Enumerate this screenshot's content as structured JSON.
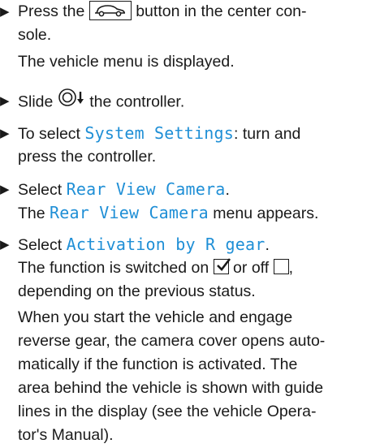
{
  "steps": [
    {
      "line1_pre": "Press the ",
      "button_icon": "car-button-icon",
      "line1_post": " button in the center con-",
      "line2": "sole.",
      "result": "The vehicle menu is displayed."
    },
    {
      "pre": "Slide ",
      "controller_icon": "controller-slide-down-icon",
      "post": " the controller."
    },
    {
      "pre": "To select ",
      "menu": "System Settings",
      "post": ": turn and",
      "line2": "press the controller."
    },
    {
      "pre": "Select ",
      "menu": "Rear View Camera",
      "post": ".",
      "result_pre": "The ",
      "result_menu": "Rear View Camera",
      "result_post": " menu appears."
    },
    {
      "pre": "Select ",
      "menu": "Activation by R gear",
      "post": ".",
      "r1_pre": "The function is switched on ",
      "checked_icon": "checkbox-checked-icon",
      "r1_mid": " or off ",
      "unchecked_icon": "checkbox-unchecked-icon",
      "r1_post": ",",
      "r2": "depending on the previous status."
    }
  ],
  "paragraph": [
    "When you start the vehicle and engage",
    "reverse gear, the camera cover opens auto-",
    "matically if the function is activated. The",
    "area behind the vehicle is shown with guide",
    "lines in the display (see the vehicle Opera-",
    "tor's Manual)."
  ],
  "bullet_glyph": "▶"
}
